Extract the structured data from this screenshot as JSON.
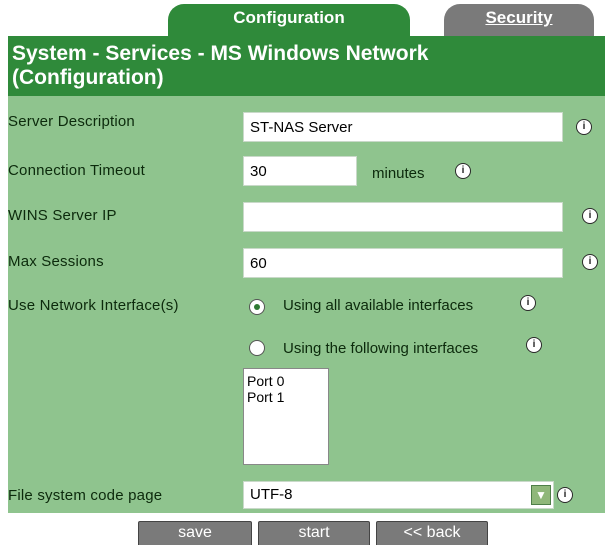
{
  "tabs": [
    {
      "label": "Configuration",
      "active": true
    },
    {
      "label": "Security",
      "active": false
    }
  ],
  "header": {
    "title": "System - Services - MS Windows Network (Configuration)"
  },
  "form": {
    "server_description": {
      "label": "Server Description",
      "value": "ST-NAS Server"
    },
    "connection_timeout": {
      "label": "Connection Timeout",
      "value": "30",
      "unit": "minutes"
    },
    "wins_server_ip": {
      "label": "WINS Server IP",
      "value": ""
    },
    "max_sessions": {
      "label": "Max Sessions",
      "value": "60"
    },
    "network_interfaces": {
      "label": "Use Network Interface(s)",
      "options": [
        {
          "label": "Using all available interfaces",
          "selected": true
        },
        {
          "label": "Using the following interfaces",
          "selected": false
        }
      ],
      "ports": [
        "Port 0",
        "Port 1"
      ]
    },
    "code_page": {
      "label": "File system code page",
      "value": "UTF-8"
    }
  },
  "buttons": {
    "save": "save",
    "start": "start",
    "back": "<< back"
  },
  "colors": {
    "header": "#2f8a3a",
    "panel": "#8fc48e",
    "inactive_tab": "#7a7a7a"
  },
  "icons": {
    "info": "info-icon",
    "dropdown": "chevron-down-icon"
  }
}
